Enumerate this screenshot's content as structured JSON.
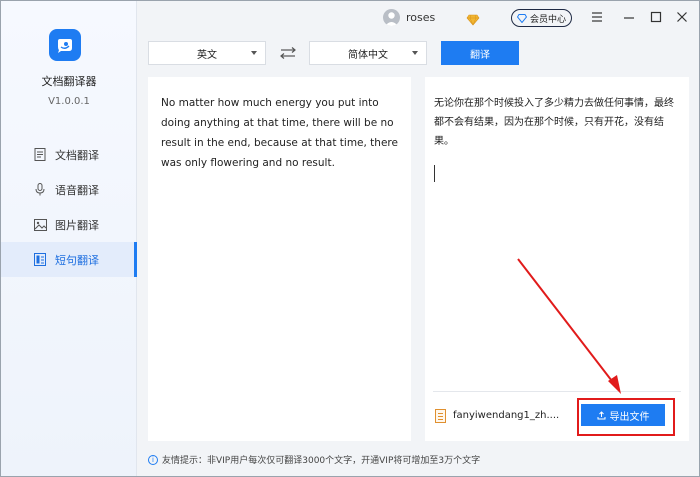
{
  "app": {
    "name": "文档翻译器",
    "version": "V1.0.0.1"
  },
  "sidebar": {
    "items": [
      {
        "label": "文档翻译",
        "icon": "document-icon"
      },
      {
        "label": "语音翻译",
        "icon": "microphone-icon"
      },
      {
        "label": "图片翻译",
        "icon": "image-icon"
      },
      {
        "label": "短句翻译",
        "icon": "text-icon",
        "active": true
      }
    ]
  },
  "header": {
    "user": "roses",
    "vip_label": "会员中心"
  },
  "toolbar": {
    "source_lang": "英文",
    "target_lang": "简体中文",
    "translate_label": "翻译"
  },
  "source": {
    "text": "No matter how much energy you put into doing anything at that time, there will be no result in the end, because at that time, there was only flowering and no result."
  },
  "target": {
    "text": "无论你在那个时候投入了多少精力去做任何事情，最终都不会有结果，因为在那个时候，只有开花，没有结果。",
    "file_name": "fanyiwendang1_zh....",
    "export_label": "导出文件"
  },
  "footer": {
    "tip": "友情提示：非VIP用户每次仅可翻译3000个文字，开通VIP将可增加至3万个文字"
  },
  "colors": {
    "accent": "#1e7cf2",
    "annotation": "#e11b1b"
  }
}
